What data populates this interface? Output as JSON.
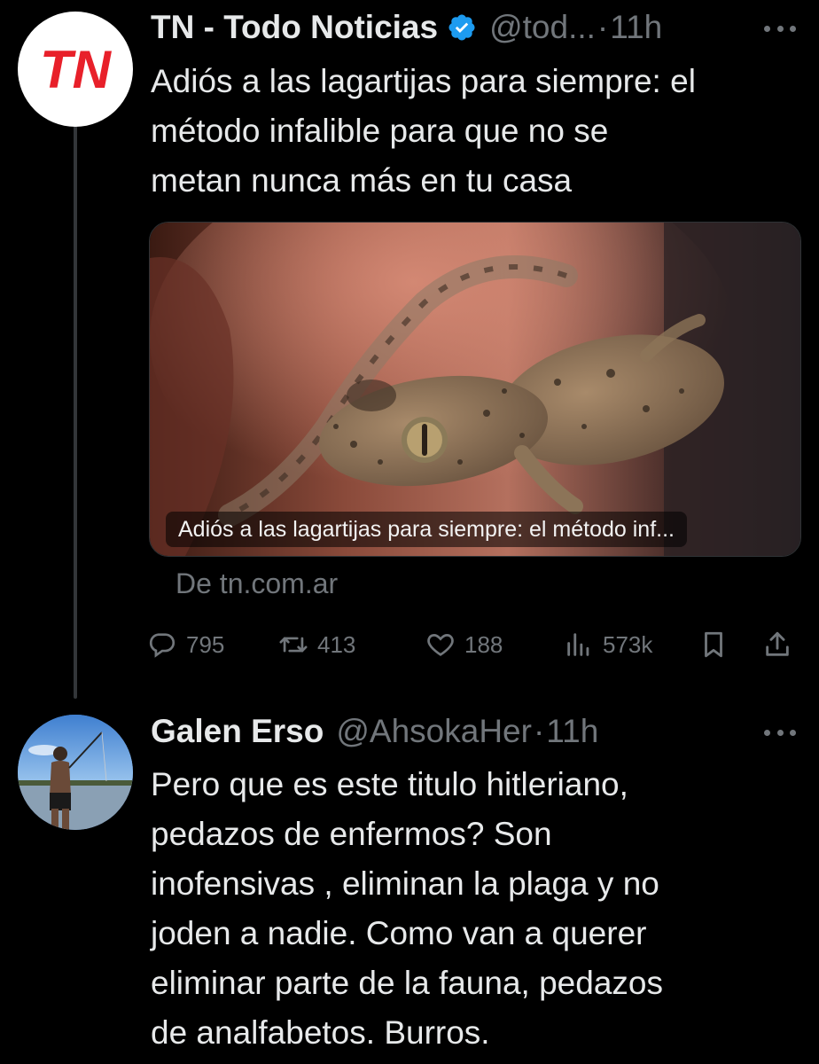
{
  "tweets": [
    {
      "author_name": "TN - Todo Noticias",
      "handle": "@tod...",
      "separator": "·",
      "time": "11h",
      "avatar_text": "TN",
      "text_lines": [
        "Adiós a las lagartijas para siempre: el",
        "método infalible para que no se",
        "metan nunca más en tu casa"
      ],
      "card": {
        "caption": "Adiós a las lagartijas para siempre: el método inf...",
        "source": "De tn.com.ar"
      },
      "actions": {
        "replies": "795",
        "retweets": "413",
        "likes": "188",
        "views": "573k"
      }
    },
    {
      "author_name": "Galen Erso",
      "handle": "@AhsokaHer",
      "separator": "·",
      "time": "11h",
      "text_lines": [
        "Pero que es este titulo hitleriano,",
        "pedazos de enfermos? Son",
        "inofensivas , eliminan la plaga y no",
        "joden a nadie. Como van a querer",
        "eliminar parte de la fauna, pedazos",
        "de analfabetos. Burros."
      ]
    }
  ],
  "icons": {
    "verified": "verified-badge-icon",
    "more": "more-options-icon",
    "reply": "reply-icon",
    "retweet": "retweet-icon",
    "like": "heart-icon",
    "views": "views-icon",
    "bookmark": "bookmark-icon",
    "share": "share-icon"
  },
  "colors": {
    "background": "#000000",
    "text": "#e7e9ea",
    "secondary": "#71767b",
    "verified": "#1d9bf0",
    "tn_brand": "#e8202a"
  }
}
